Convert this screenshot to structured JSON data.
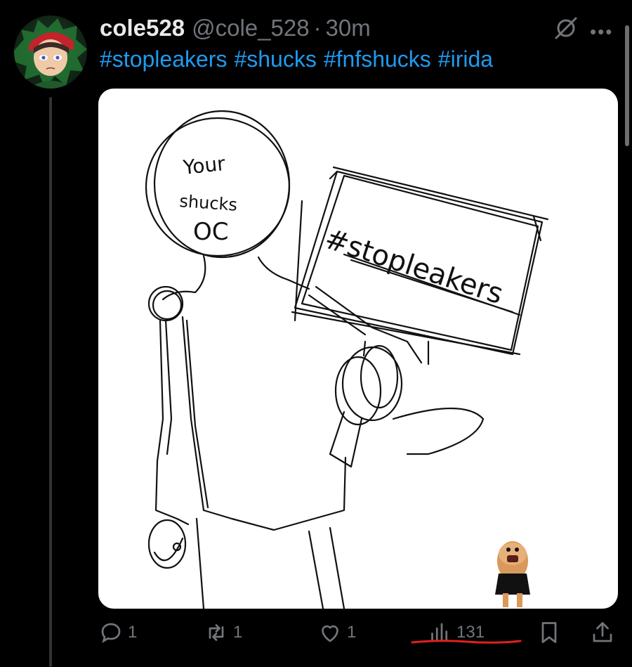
{
  "tweet": {
    "display_name": "cole528",
    "handle": "@cole_528",
    "separator": "·",
    "time": "30m",
    "hashtags": [
      "#stopleakers",
      "#shucks",
      "#fnfshucks",
      "#irida"
    ],
    "image_text": {
      "head_line1": "Your",
      "head_line2": "shucks",
      "head_line3": "OC",
      "sign": "#stopleakers"
    }
  },
  "actions": {
    "reply_count": "1",
    "retweet_count": "1",
    "like_count": "1",
    "views_count": "131"
  },
  "icons": {
    "reply": "reply-icon",
    "retweet": "retweet-icon",
    "like": "heart-icon",
    "views": "views-chart-icon",
    "bookmark": "bookmark-icon",
    "share": "share-icon",
    "grok": "grok-icon",
    "more": "more-icon"
  },
  "colors": {
    "background": "#000000",
    "text": "#e7e9ea",
    "muted": "#71767b",
    "link": "#1d9bf0",
    "underline": "#e0201c"
  }
}
